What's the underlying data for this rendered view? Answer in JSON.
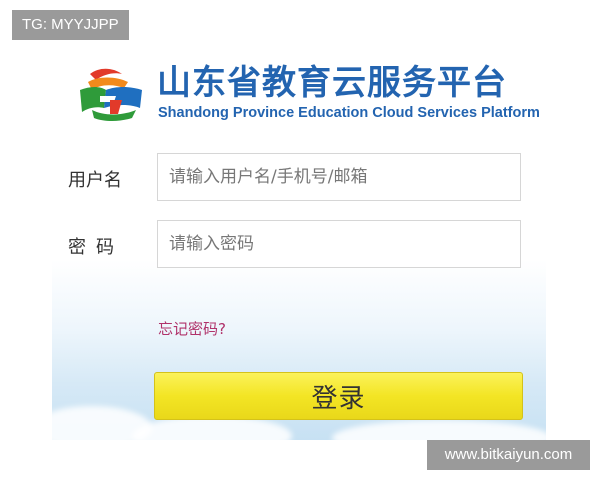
{
  "overlay_tag": "TG: MYYJJPP",
  "watermark": "www.bitkaiyun.com",
  "header": {
    "title_cn": "山东省教育云服务平台",
    "title_en": "Shandong Province Education Cloud Services Platform",
    "logo_icon": "shandong-education-cloud-logo"
  },
  "form": {
    "username_label": "用户名",
    "username_placeholder": "请输入用户名/手机号/邮箱",
    "password_label": "密码",
    "password_placeholder": "请输入密码",
    "forgot_link": "忘记密码?",
    "login_button": "登录"
  },
  "colors": {
    "brand_blue": "#2364b0",
    "link": "#b0326a",
    "button": "#f3e524"
  }
}
